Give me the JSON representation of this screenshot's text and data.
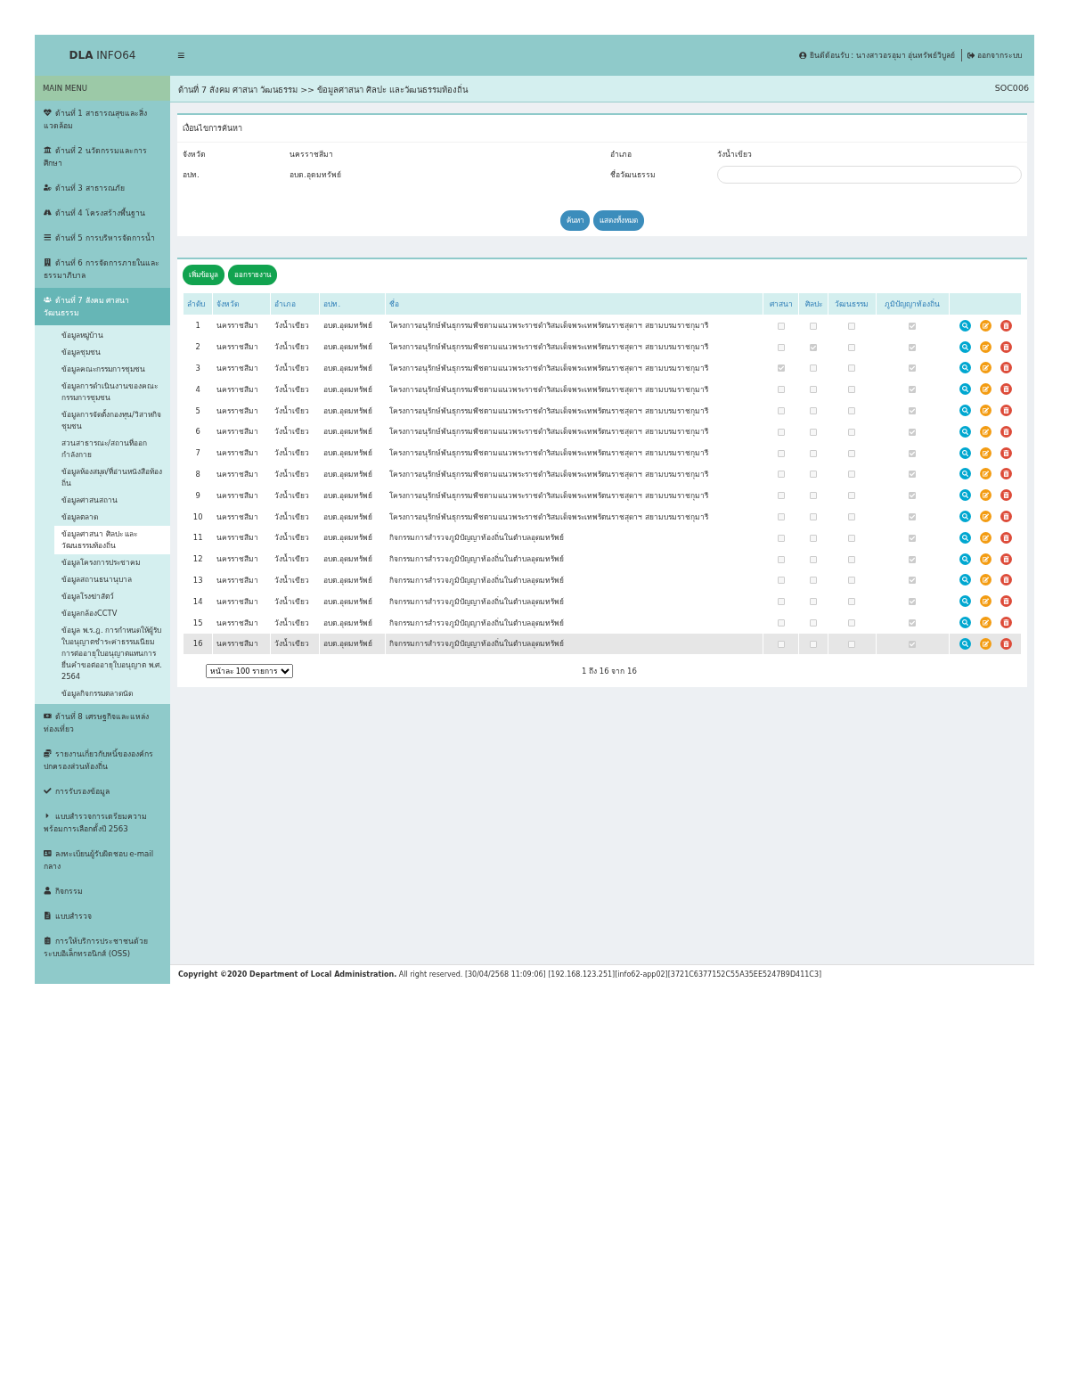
{
  "header": {
    "brand": "**DLA** INFO64",
    "menu_icon": "≡",
    "welcome": "ยินดีต้อนรับ : นางสาวอรอุมา อุ่นทรัพย์วิบูลย์",
    "logout": "ออกจากระบบ"
  },
  "sidebar": {
    "title": "MAIN MENU",
    "items": [
      {
        "label": "ด้านที่ 1 สาธารณสุขและสิ่งแวดล้อม",
        "expanded": false
      },
      {
        "label": "ด้านที่ 2 นวัตกรรมและการศึกษา",
        "expanded": false
      },
      {
        "label": "ด้านที่ 3 สาธารณภัย",
        "expanded": false
      },
      {
        "label": "ด้านที่ 4 โครงสร้างพื้นฐาน",
        "expanded": false
      },
      {
        "label": "ด้านที่ 5 การบริหารจัดการน้ำ",
        "expanded": false
      },
      {
        "label": "ด้านที่ 6 การจัดการภายในและธรรมาภิบาล",
        "expanded": false
      },
      {
        "label": "ด้านที่ 7 สังคม ศาสนา วัฒนธรรม",
        "expanded": true,
        "children": [
          {
            "label": "ข้อมูลหมู่บ้าน",
            "selected": false
          },
          {
            "label": "ข้อมูลชุมชน",
            "selected": false
          },
          {
            "label": "ข้อมูลคณะกรรมการชุมชน",
            "selected": false
          },
          {
            "label": "ข้อมูลการดำเนินงานของคณะกรรมการชุมชน",
            "selected": false
          },
          {
            "label": "ข้อมูลการจัดตั้งกองทุน/วิสาหกิจชุมชน",
            "selected": false
          },
          {
            "label": "สวนสาธารณะ/สถานที่ออกกำลังกาย",
            "selected": false
          },
          {
            "label": "ข้อมูลห้องสมุด/ที่อ่านหนังสือท้องถิ่น",
            "selected": false
          },
          {
            "label": "ข้อมูลศาสนสถาน",
            "selected": false
          },
          {
            "label": "ข้อมูลตลาด",
            "selected": false
          },
          {
            "label": "ข้อมูลศาสนา ศิลปะ และวัฒนธรรมท้องถิ่น",
            "selected": true
          },
          {
            "label": "ข้อมูลโครงการประชาคม",
            "selected": false
          },
          {
            "label": "ข้อมูลสถานธนานุบาล",
            "selected": false
          },
          {
            "label": "ข้อมูลโรงฆ่าสัตว์",
            "selected": false
          },
          {
            "label": "ข้อมูลกล้องCCTV",
            "selected": false
          },
          {
            "label": "ข้อมูล พ.ร.ฎ. การกำหนดให้ผู้รับใบอนุญาตชำระค่าธรรมเนียมการต่ออายุใบอนุญาตแทนการยื่นคำขอต่ออายุใบอนุญาต พ.ศ. 2564",
            "selected": false
          },
          {
            "label": "ข้อมูลกิจกรรมตลาดนัด",
            "selected": false
          }
        ]
      },
      {
        "label": "ด้านที่ 8 เศรษฐกิจและแหล่งท่องเที่ยว",
        "expanded": false
      },
      {
        "label": "รายงานเกี่ยวกับหนี้ขององค์กรปกครองส่วนท้องถิ่น",
        "expanded": false
      },
      {
        "label": "การรับรองข้อมูล",
        "expanded": false
      },
      {
        "label": "แบบสำรวจการเตรียมความพร้อมการเลือกตั้งปี 2563",
        "expanded": false
      },
      {
        "label": "ลงทะเบียนผู้รับผิดชอบ e-mail กลาง",
        "expanded": false
      },
      {
        "label": "กิจกรรม",
        "expanded": false
      },
      {
        "label": "แบบสำรวจ",
        "expanded": false
      },
      {
        "label": "การให้บริการประชาชนด้วยระบบอิเล็กทรอนิกส์ (OSS)",
        "expanded": false
      }
    ]
  },
  "breadcrumb": {
    "path": "ด้านที่ 7 สังคม ศาสนา วัฒนธรรม >>  ข้อมูลศาสนา ศิลปะ และวัฒนธรรมท้องถิ่น",
    "code": "SOC006"
  },
  "search": {
    "title": "เงื่อนไขการค้นหา",
    "fields": [
      {
        "label": "จังหวัด",
        "value": "นครราชสีมา",
        "kind": "text"
      },
      {
        "label": "อำเภอ",
        "value": "วังน้ำเขียว",
        "kind": "text"
      },
      {
        "label": "อปท.",
        "value": "อบต.อุดมทรัพย์",
        "kind": "text"
      },
      {
        "label": "ชื่อวัฒนธรรม",
        "kind": "input"
      }
    ],
    "buttons": [
      "ค้นหา",
      "แสดงทั้งหมด"
    ]
  },
  "list": {
    "buttons": [
      "เพิ่มข้อมูล",
      "ออกรายงาน"
    ],
    "columns": [
      "ลำดับ",
      "จังหวัด",
      "อำเภอ",
      "อปท.",
      "ชื่อ",
      "ศาสนา",
      "ศิลปะ",
      "วัฒนธรรม",
      "ภูมิปัญญาท้องถิ่น"
    ],
    "rows": [
      {
        "no": "1",
        "province": "นครราชสีมา",
        "district": "วังน้ำเขียว",
        "org": "อบต.อุดมทรัพย์",
        "name": "โครงการอนุรักษ์พันธุกรรมพืชตามแนวพระราชดำริสมเด็จพระเทพรัตนราชสุดาฯ สยามบรมราชกุมารี",
        "religion": false,
        "art": false,
        "culture": false,
        "wisdom": true,
        "selected": false
      },
      {
        "no": "2",
        "province": "นครราชสีมา",
        "district": "วังน้ำเขียว",
        "org": "อบต.อุดมทรัพย์",
        "name": "โครงการอนุรักษ์พันธุกรรมพืชตามแนวพระราชดำริสมเด็จพระเทพรัตนราชสุดาฯ สยามบรมราชกุมารี",
        "religion": false,
        "art": true,
        "culture": false,
        "wisdom": true,
        "selected": false
      },
      {
        "no": "3",
        "province": "นครราชสีมา",
        "district": "วังน้ำเขียว",
        "org": "อบต.อุดมทรัพย์",
        "name": "โครงการอนุรักษ์พันธุกรรมพืชตามแนวพระราชดำริสมเด็จพระเทพรัตนราชสุดาฯ สยามบรมราชกุมารี",
        "religion": true,
        "art": false,
        "culture": false,
        "wisdom": true,
        "selected": false
      },
      {
        "no": "4",
        "province": "นครราชสีมา",
        "district": "วังน้ำเขียว",
        "org": "อบต.อุดมทรัพย์",
        "name": "โครงการอนุรักษ์พันธุกรรมพืชตามแนวพระราชดำริสมเด็จพระเทพรัตนราชสุดาฯ สยามบรมราชกุมารี",
        "religion": false,
        "art": false,
        "culture": false,
        "wisdom": true,
        "selected": false
      },
      {
        "no": "5",
        "province": "นครราชสีมา",
        "district": "วังน้ำเขียว",
        "org": "อบต.อุดมทรัพย์",
        "name": "โครงการอนุรักษ์พันธุกรรมพืชตามแนวพระราชดำริสมเด็จพระเทพรัตนราชสุดาฯ สยามบรมราชกุมารี",
        "religion": false,
        "art": false,
        "culture": false,
        "wisdom": true,
        "selected": false
      },
      {
        "no": "6",
        "province": "นครราชสีมา",
        "district": "วังน้ำเขียว",
        "org": "อบต.อุดมทรัพย์",
        "name": "โครงการอนุรักษ์พันธุกรรมพืชตามแนวพระราชดำริสมเด็จพระเทพรัตนราชสุดาฯ สยามบรมราชกุมารี",
        "religion": false,
        "art": false,
        "culture": false,
        "wisdom": true,
        "selected": false
      },
      {
        "no": "7",
        "province": "นครราชสีมา",
        "district": "วังน้ำเขียว",
        "org": "อบต.อุดมทรัพย์",
        "name": "โครงการอนุรักษ์พันธุกรรมพืชตามแนวพระราชดำริสมเด็จพระเทพรัตนราชสุดาฯ สยามบรมราชกุมารี",
        "religion": false,
        "art": false,
        "culture": false,
        "wisdom": true,
        "selected": false
      },
      {
        "no": "8",
        "province": "นครราชสีมา",
        "district": "วังน้ำเขียว",
        "org": "อบต.อุดมทรัพย์",
        "name": "โครงการอนุรักษ์พันธุกรรมพืชตามแนวพระราชดำริสมเด็จพระเทพรัตนราชสุดาฯ สยามบรมราชกุมารี",
        "religion": false,
        "art": false,
        "culture": false,
        "wisdom": true,
        "selected": false
      },
      {
        "no": "9",
        "province": "นครราชสีมา",
        "district": "วังน้ำเขียว",
        "org": "อบต.อุดมทรัพย์",
        "name": "โครงการอนุรักษ์พันธุกรรมพืชตามแนวพระราชดำริสมเด็จพระเทพรัตนราชสุดาฯ สยามบรมราชกุมารี",
        "religion": false,
        "art": false,
        "culture": false,
        "wisdom": true,
        "selected": false
      },
      {
        "no": "10",
        "province": "นครราชสีมา",
        "district": "วังน้ำเขียว",
        "org": "อบต.อุดมทรัพย์",
        "name": "โครงการอนุรักษ์พันธุกรรมพืชตามแนวพระราชดำริสมเด็จพระเทพรัตนราชสุดาฯ สยามบรมราชกุมารี",
        "religion": false,
        "art": false,
        "culture": false,
        "wisdom": true,
        "selected": false
      },
      {
        "no": "11",
        "province": "นครราชสีมา",
        "district": "วังน้ำเขียว",
        "org": "อบต.อุดมทรัพย์",
        "name": "กิจกรรมการสำรวจภูมิปัญญาท้องถิ่นในตำบลอุดมทรัพย์",
        "religion": false,
        "art": false,
        "culture": false,
        "wisdom": true,
        "selected": false
      },
      {
        "no": "12",
        "province": "นครราชสีมา",
        "district": "วังน้ำเขียว",
        "org": "อบต.อุดมทรัพย์",
        "name": "กิจกรรมการสำรวจภูมิปัญญาท้องถิ่นในตำบลอุดมทรัพย์",
        "religion": false,
        "art": false,
        "culture": false,
        "wisdom": true,
        "selected": false
      },
      {
        "no": "13",
        "province": "นครราชสีมา",
        "district": "วังน้ำเขียว",
        "org": "อบต.อุดมทรัพย์",
        "name": "กิจกรรมการสำรวจภูมิปัญญาท้องถิ่นในตำบลอุดมทรัพย์",
        "religion": false,
        "art": false,
        "culture": false,
        "wisdom": true,
        "selected": false
      },
      {
        "no": "14",
        "province": "นครราชสีมา",
        "district": "วังน้ำเขียว",
        "org": "อบต.อุดมทรัพย์",
        "name": "กิจกรรมการสำรวจภูมิปัญญาท้องถิ่นในตำบลอุดมทรัพย์",
        "religion": false,
        "art": false,
        "culture": false,
        "wisdom": true,
        "selected": false
      },
      {
        "no": "15",
        "province": "นครราชสีมา",
        "district": "วังน้ำเขียว",
        "org": "อบต.อุดมทรัพย์",
        "name": "กิจกรรมการสำรวจภูมิปัญญาท้องถิ่นในตำบลอุดมทรัพย์",
        "religion": false,
        "art": false,
        "culture": false,
        "wisdom": true,
        "selected": false
      },
      {
        "no": "16",
        "province": "นครราชสีมา",
        "district": "วังน้ำเขียว",
        "org": "อบต.อุดมทรัพย์",
        "name": "กิจกรรมการสำรวจภูมิปัญญาท้องถิ่นในตำบลอุดมทรัพย์",
        "religion": false,
        "art": false,
        "culture": false,
        "wisdom": true,
        "selected": true
      }
    ],
    "page_size": "หน้าละ 100 รายการ",
    "summary": "1 ถึง 16 จาก 16"
  },
  "footer": "**Copyright ©2020 Department of Local Administration.** All right reserved. [30/04/2568 11:09:06] [192.168.123.251][info62-app02][3721C6377152C55A35EE5247B9D411C3]"
}
